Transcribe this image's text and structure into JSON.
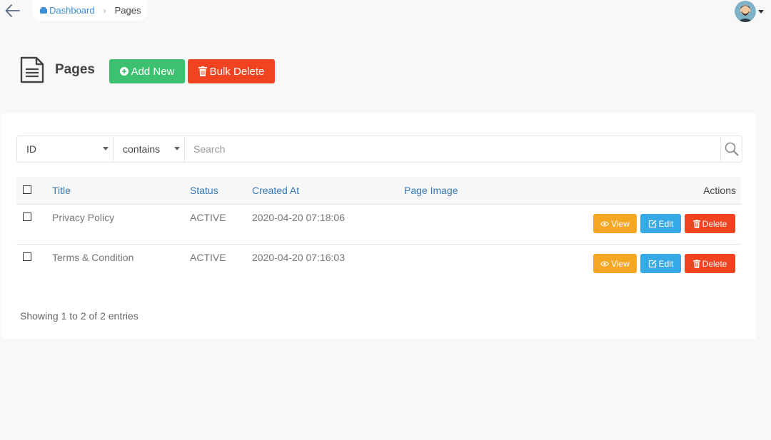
{
  "topbar": {
    "breadcrumb": {
      "home_label": "Dashboard",
      "current_label": "Pages"
    }
  },
  "header": {
    "title": "Pages",
    "add_label": "Add New",
    "bulk_delete_label": "Bulk Delete"
  },
  "filters": {
    "field_value": "ID",
    "operator_value": "contains",
    "search_placeholder": "Search"
  },
  "table": {
    "columns": {
      "title": "Title",
      "status": "Status",
      "created": "Created At",
      "image": "Page Image",
      "actions": "Actions"
    },
    "rows": [
      {
        "title": "Privacy Policy",
        "status": "ACTIVE",
        "created": "2020-04-20 07:18:06",
        "image": ""
      },
      {
        "title": "Terms & Condition",
        "status": "ACTIVE",
        "created": "2020-04-20 07:16:03",
        "image": ""
      }
    ],
    "actions": {
      "view": "View",
      "edit": "Edit",
      "delete": "Delete"
    }
  },
  "footer": {
    "info": "Showing 1 to 2 of 2 entries"
  },
  "colors": {
    "add": "#3cc170",
    "danger": "#f1431f",
    "view": "#f5a623",
    "edit": "#35aae6",
    "link": "#3777b2"
  }
}
